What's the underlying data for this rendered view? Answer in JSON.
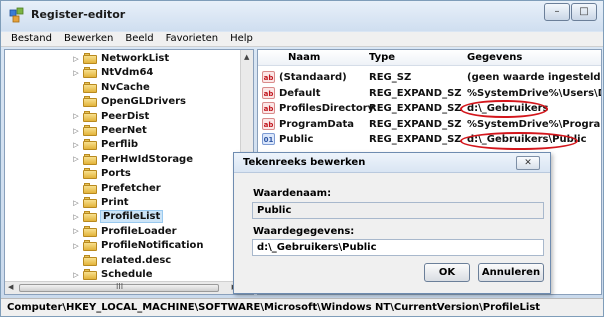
{
  "window": {
    "title": "Register-editor",
    "minimize_glyph": "–",
    "maximize_glyph": "□"
  },
  "menu": [
    "Bestand",
    "Bewerken",
    "Beeld",
    "Favorieten",
    "Help"
  ],
  "tree": {
    "items": [
      {
        "label": "NetworkList",
        "expandable": true
      },
      {
        "label": "NtVdm64",
        "expandable": true
      },
      {
        "label": "NvCache",
        "expandable": false
      },
      {
        "label": "OpenGLDrivers",
        "expandable": false
      },
      {
        "label": "PeerDist",
        "expandable": true
      },
      {
        "label": "PeerNet",
        "expandable": true
      },
      {
        "label": "Perflib",
        "expandable": true
      },
      {
        "label": "PerHwIdStorage",
        "expandable": true
      },
      {
        "label": "Ports",
        "expandable": false
      },
      {
        "label": "Prefetcher",
        "expandable": false
      },
      {
        "label": "Print",
        "expandable": true
      },
      {
        "label": "ProfileList",
        "expandable": true,
        "selected": true
      },
      {
        "label": "ProfileLoader",
        "expandable": true
      },
      {
        "label": "ProfileNotification",
        "expandable": true
      },
      {
        "label": "related.desc",
        "expandable": false
      },
      {
        "label": "Schedule",
        "expandable": true
      }
    ],
    "scroll_grip": "III"
  },
  "list": {
    "headers": {
      "name": "Naam",
      "type": "Type",
      "data": "Gegevens"
    },
    "rows": [
      {
        "icon": "ab",
        "name": "(Standaard)",
        "type": "REG_SZ",
        "data": "(geen waarde ingesteld)"
      },
      {
        "icon": "ab",
        "name": "Default",
        "type": "REG_EXPAND_SZ",
        "data": "%SystemDrive%\\Users\\Default"
      },
      {
        "icon": "ab",
        "name": "ProfilesDirectory",
        "type": "REG_EXPAND_SZ",
        "data": "d:\\_Gebruikers",
        "highlighted": true
      },
      {
        "icon": "ab",
        "name": "ProgramData",
        "type": "REG_EXPAND_SZ",
        "data": "%SystemDrive%\\ProgramData"
      },
      {
        "icon": "bin",
        "name": "Public",
        "type": "REG_EXPAND_SZ",
        "data": "d:\\_Gebruikers\\Public",
        "highlighted": true
      }
    ],
    "highlight_color": "#d3161c"
  },
  "dialog": {
    "title": "Tekenreeks bewerken",
    "close_glyph": "✕",
    "name_label": "Waardenaam:",
    "name_value": "Public",
    "data_label": "Waardegegevens:",
    "data_value": "d:\\_Gebruikers\\Public",
    "ok_label": "OK",
    "cancel_label": "Annuleren"
  },
  "status": {
    "path": "Computer\\HKEY_LOCAL_MACHINE\\SOFTWARE\\Microsoft\\Windows NT\\CurrentVersion\\ProfileList"
  }
}
